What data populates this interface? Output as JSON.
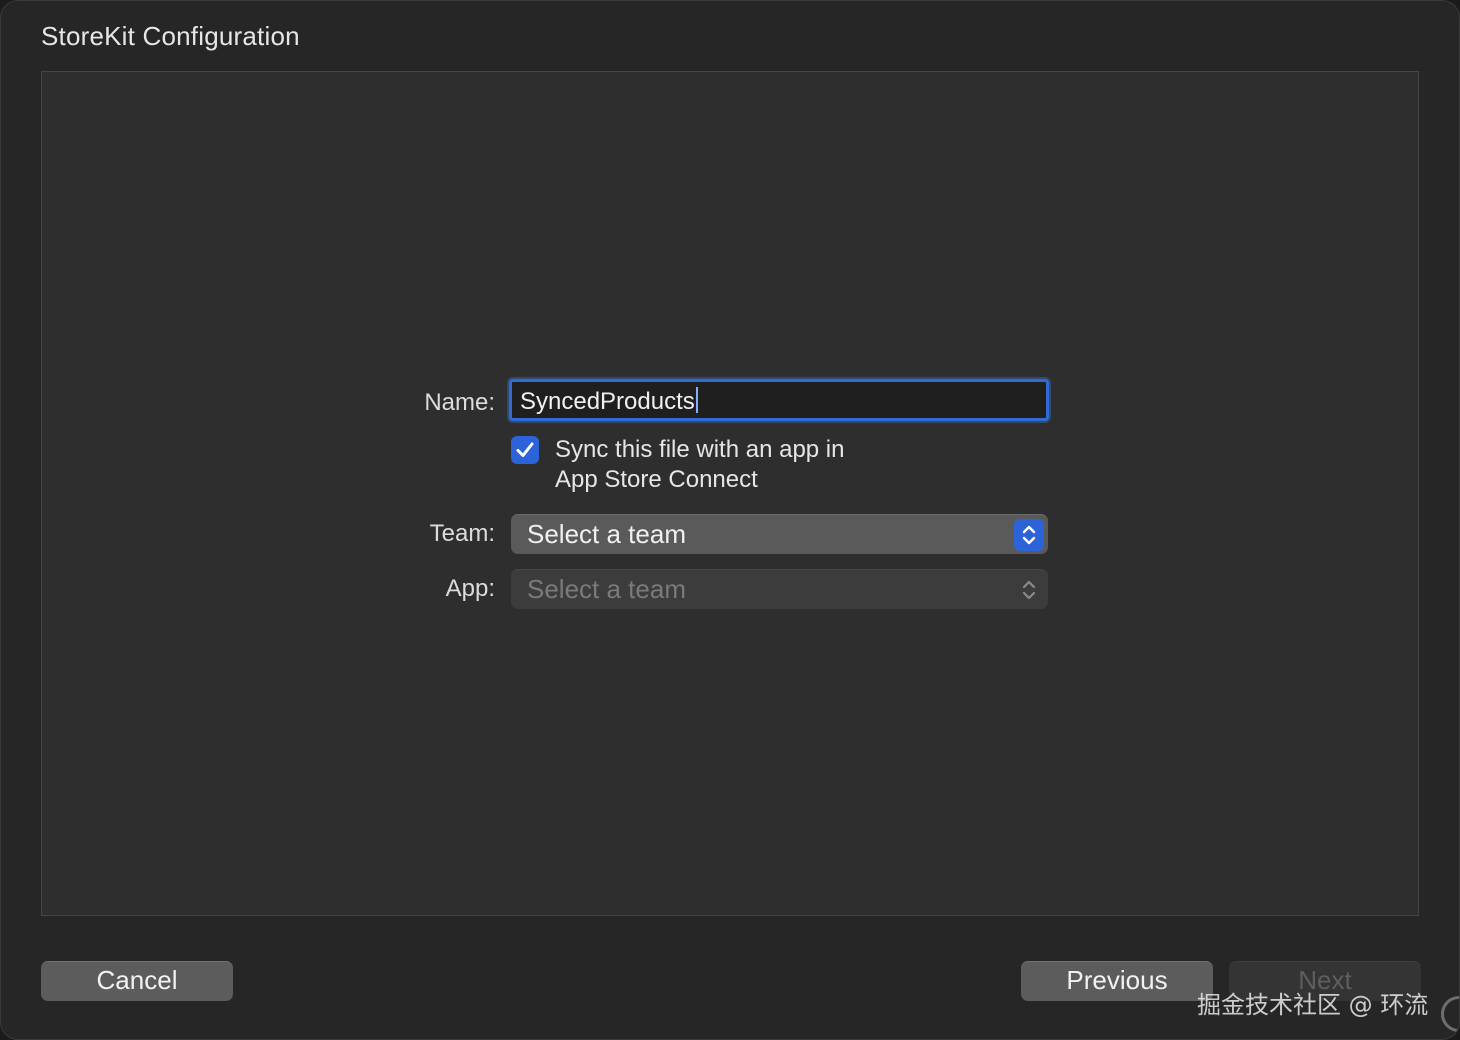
{
  "window": {
    "title": "StoreKit Configuration"
  },
  "form": {
    "name_label": "Name:",
    "name_value": "SyncedProducts",
    "sync_checked": true,
    "sync_label_line1": "Sync this file with an app in",
    "sync_label_line2": "App Store Connect",
    "team_label": "Team:",
    "team_value": "Select a team",
    "app_label": "App:",
    "app_value": "Select a team"
  },
  "buttons": {
    "cancel": "Cancel",
    "previous": "Previous",
    "next": "Next"
  },
  "watermark": "掘金技术社区 @ 环流",
  "colors": {
    "accent": "#2d63d8",
    "window_bg": "#262626",
    "panel_bg": "#2e2e2e"
  }
}
